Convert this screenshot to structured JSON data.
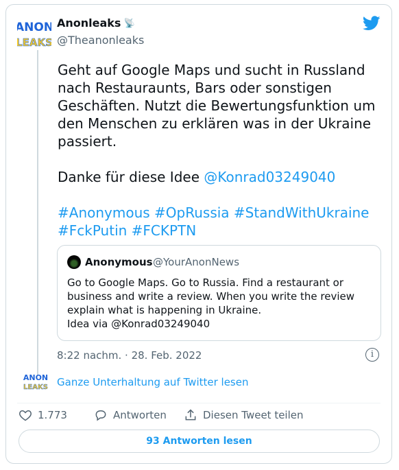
{
  "author": {
    "name": "Anonleaks",
    "handle": "@Theanonleaks",
    "logo_text_top": "ANON",
    "logo_text_bottom": "LEAKS",
    "name_badge_icon": "satellite-icon"
  },
  "tweet": {
    "paragraph1": "Geht auf Google Maps und sucht in Russland nach Restauraunts, Bars oder sonstigen Geschäften. Nutzt die Bewertungsfunktion um den Menschen zu erklären was in der Ukraine passiert.",
    "thanks": "Danke für diese Idee ",
    "mention": "@Konrad03249040",
    "hashtags_line1": "#Anonymous #OpRussia #StandWithUkraine",
    "hashtags_line2": "#FckPutin #FCKPTN",
    "timestamp": "8:22 nachm. · 28. Feb. 2022"
  },
  "quoted_tweet": {
    "name": "Anonymous",
    "handle": "@YourAnonNews",
    "text": "Go to Google Maps.  Go to Russia. Find a restaurant or business and write a review.   When you write the review explain what is happening in Ukraine.\nIdea via @Konrad03249040"
  },
  "conversation_link": "Ganze Unterhaltung auf Twitter lesen",
  "actions": {
    "like_count": "1.773",
    "reply_label": "Antworten",
    "share_label": "Diesen Tweet teilen"
  },
  "read_replies_button": "93 Antworten lesen",
  "colors": {
    "accent": "#1d9bf0",
    "text": "#0f1419",
    "muted": "#536471",
    "border": "#cfd9de",
    "logo_blue": "#1f64d8",
    "logo_yellow": "#f6c928"
  }
}
